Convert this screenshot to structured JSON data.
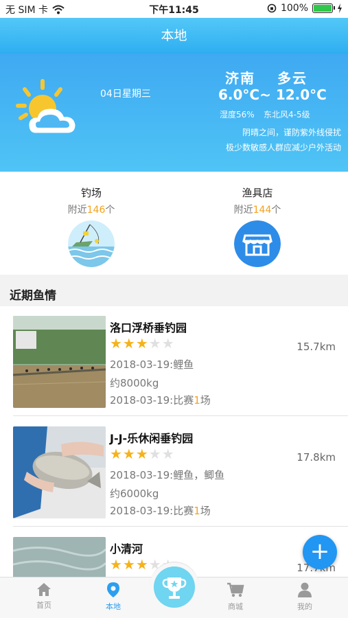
{
  "status_bar": {
    "carrier": "无 SIM 卡",
    "time": "下午11:45",
    "battery": "100%"
  },
  "nav": {
    "title": "本地"
  },
  "weather": {
    "date": "04日星期三",
    "city": "济南",
    "condition": "多云",
    "temperature": "6.0°C~ 12.0°C",
    "humidity": "湿度56%",
    "wind": "东北风4-5级",
    "tip_line1": "阴晴之间，谨防紫外线侵扰",
    "tip_line2": "极少数敏感人群应减少户外活动"
  },
  "quick_links": {
    "spots": {
      "label": "钓场",
      "near_prefix": "附近",
      "count": "146",
      "unit": "个"
    },
    "shops": {
      "label": "渔具店",
      "near_prefix": "附近",
      "count": "144",
      "unit": "个"
    }
  },
  "section_title": "近期鱼情",
  "list": [
    {
      "name": "洛口浮桥垂钓园",
      "rating": 3,
      "distance": "15.7km",
      "line1": "2018-03-19:鲤鱼",
      "line2": "约8000kg",
      "line3_prefix": "2018-03-19:比赛",
      "line3_count": "1",
      "line3_suffix": "场"
    },
    {
      "name": "J-J-乐休闲垂钓园",
      "rating": 3,
      "distance": "17.8km",
      "line1": "2018-03-19:鲤鱼，鲫鱼",
      "line2": "约6000kg",
      "line3_prefix": "2018-03-19:比赛",
      "line3_count": "1",
      "line3_suffix": "场"
    },
    {
      "name": "小清河",
      "rating": 3,
      "distance": "17.7km"
    }
  ],
  "fab_label": "+",
  "tabs": {
    "home": "首页",
    "local": "本地",
    "mall": "商城",
    "mine": "我的"
  },
  "colors": {
    "accent": "#2b9ff0",
    "highlight": "#f3a21c",
    "star": "#f5b21a"
  }
}
